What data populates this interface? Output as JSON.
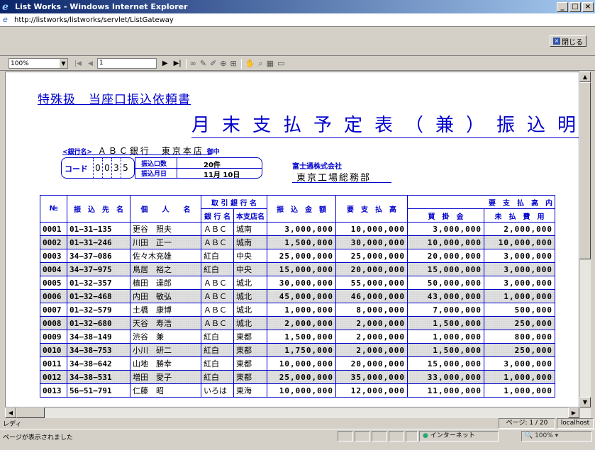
{
  "window": {
    "title": "List Works - Windows Internet Explorer",
    "minimize": "_",
    "maximize": "□",
    "close": "×"
  },
  "address": {
    "url": "http://listworks/listworks/servlet/ListGateway"
  },
  "closebar": {
    "close_label": "閉じる"
  },
  "navbar": {
    "zoom": "100%",
    "page": "1",
    "first": "|◀",
    "prev": "◀",
    "next": "▶",
    "last": "▶|"
  },
  "doc": {
    "title1": "特殊扱　当座口振込依頼書",
    "title2": "月末支払予定表（兼）振込明細",
    "bank_label": "<銀行名>",
    "bank_name": "ＡＢＣ銀行　東京本店",
    "bank_suffix": "御中",
    "code_label": "コード",
    "code_digits": [
      "0",
      "0",
      "3",
      "5"
    ],
    "count_label": "振込口数",
    "count_value": "20件",
    "date_label": "振込月日",
    "date_value": "11月 10日",
    "company": "富士通株式会社",
    "dept": "東京工場総務部"
  },
  "table": {
    "headers": {
      "no": "№",
      "dest": "振　込　先　名",
      "person": "個　　人　　名",
      "bank_group": "取 引 銀 行 名",
      "bank": "銀 行 名",
      "branch": "本支店名",
      "amount": "振　込　金　額",
      "total": "要　支　払　高",
      "breakdown": "要　支　払　高　内",
      "buy": "買　掛　金",
      "unpaid": "未　払　費　用"
    },
    "rows": [
      {
        "no": "0001",
        "code": "01−31−135",
        "name": "更谷　照夫",
        "bank": "ＡＢＣ",
        "branch": "城南",
        "amount": "3,000,000",
        "total": "10,000,000",
        "buy": "3,000,000",
        "unpaid": "2,000,000",
        "shaded": false
      },
      {
        "no": "0002",
        "code": "01−31−246",
        "name": "川田　正一",
        "bank": "ＡＢＣ",
        "branch": "城南",
        "amount": "1,500,000",
        "total": "30,000,000",
        "buy": "10,000,000",
        "unpaid": "10,000,000",
        "shaded": true
      },
      {
        "no": "0003",
        "code": "34−37−086",
        "name": "佐々木充雄",
        "bank": "紅白",
        "branch": "中央",
        "amount": "25,000,000",
        "total": "25,000,000",
        "buy": "20,000,000",
        "unpaid": "3,000,000",
        "shaded": false
      },
      {
        "no": "0004",
        "code": "34−37−975",
        "name": "鳥居　裕之",
        "bank": "紅白",
        "branch": "中央",
        "amount": "15,000,000",
        "total": "20,000,000",
        "buy": "15,000,000",
        "unpaid": "3,000,000",
        "shaded": true
      },
      {
        "no": "0005",
        "code": "01−32−357",
        "name": "植田　達郎",
        "bank": "ＡＢＣ",
        "branch": "城北",
        "amount": "30,000,000",
        "total": "55,000,000",
        "buy": "50,000,000",
        "unpaid": "3,000,000",
        "shaded": false
      },
      {
        "no": "0006",
        "code": "01−32−468",
        "name": "内田　敏弘",
        "bank": "ＡＢＣ",
        "branch": "城北",
        "amount": "45,000,000",
        "total": "46,000,000",
        "buy": "43,000,000",
        "unpaid": "1,000,000",
        "shaded": true
      },
      {
        "no": "0007",
        "code": "01−32−579",
        "name": "土橋　康博",
        "bank": "ＡＢＣ",
        "branch": "城北",
        "amount": "1,000,000",
        "total": "8,000,000",
        "buy": "7,000,000",
        "unpaid": "500,000",
        "shaded": false
      },
      {
        "no": "0008",
        "code": "01−32−680",
        "name": "天谷　寿浩",
        "bank": "ＡＢＣ",
        "branch": "城北",
        "amount": "2,000,000",
        "total": "2,000,000",
        "buy": "1,500,000",
        "unpaid": "250,000",
        "shaded": true
      },
      {
        "no": "0009",
        "code": "34−38−149",
        "name": "渋谷　兼",
        "bank": "紅白",
        "branch": "東都",
        "amount": "1,500,000",
        "total": "2,000,000",
        "buy": "1,000,000",
        "unpaid": "800,000",
        "shaded": false
      },
      {
        "no": "0010",
        "code": "34−38−753",
        "name": "小川　研二",
        "bank": "紅白",
        "branch": "東都",
        "amount": "1,750,000",
        "total": "2,000,000",
        "buy": "1,500,000",
        "unpaid": "250,000",
        "shaded": true
      },
      {
        "no": "0011",
        "code": "34−38−642",
        "name": "山地　勝幸",
        "bank": "紅白",
        "branch": "東都",
        "amount": "10,000,000",
        "total": "20,000,000",
        "buy": "15,000,000",
        "unpaid": "3,000,000",
        "shaded": false
      },
      {
        "no": "0012",
        "code": "34−38−531",
        "name": "増田　愛子",
        "bank": "紅白",
        "branch": "東都",
        "amount": "25,000,000",
        "total": "35,000,000",
        "buy": "33,000,000",
        "unpaid": "1,000,000",
        "shaded": true
      },
      {
        "no": "0013",
        "code": "56−51−791",
        "name": "仁藤　昭",
        "bank": "いろは",
        "branch": "東海",
        "amount": "10,000,000",
        "total": "12,000,000",
        "buy": "11,000,000",
        "unpaid": "1,000,000",
        "shaded": false
      }
    ]
  },
  "status": {
    "ready": "レディ",
    "page": "ページ: 1 / 20",
    "host": "localhost"
  },
  "ie_status": {
    "text": "ページが表示されました",
    "zone": "インターネット",
    "zoom": "100%"
  }
}
